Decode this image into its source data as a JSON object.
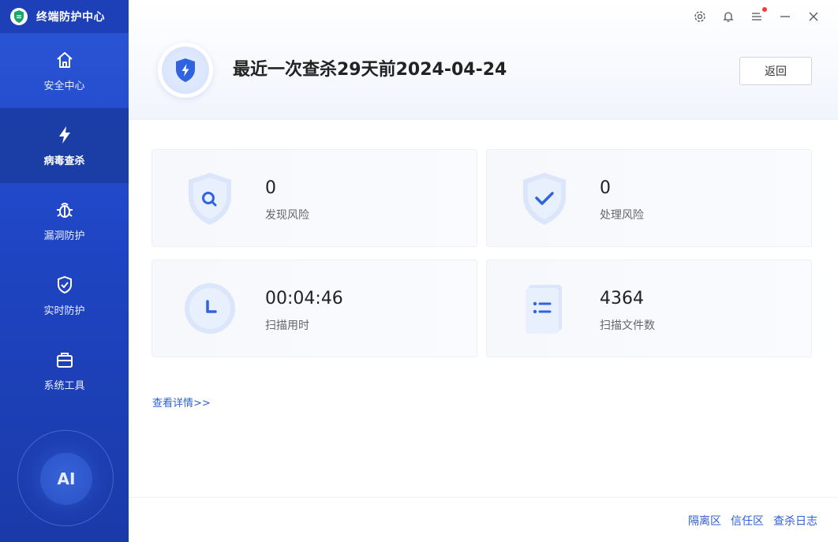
{
  "app": {
    "title": "终端防护中心"
  },
  "sidebar": {
    "items": [
      {
        "label": "安全中心",
        "icon": "home-icon"
      },
      {
        "label": "病毒查杀",
        "icon": "lightning-icon",
        "active": true
      },
      {
        "label": "漏洞防护",
        "icon": "bug-icon"
      },
      {
        "label": "实时防护",
        "icon": "shield-check-icon"
      },
      {
        "label": "系统工具",
        "icon": "toolbox-icon"
      }
    ],
    "ai_label": "AI"
  },
  "header": {
    "scan_title": "最近一次查杀29天前2024-04-24",
    "back_label": "返回"
  },
  "stats": [
    {
      "value": "0",
      "label": "发现风险",
      "icon": "shield-search-icon"
    },
    {
      "value": "0",
      "label": "处理风险",
      "icon": "shield-check-icon"
    },
    {
      "value": "00:04:46",
      "label": "扫描用时",
      "icon": "clock-icon"
    },
    {
      "value": "4364",
      "label": "扫描文件数",
      "icon": "file-list-icon"
    }
  ],
  "details_link": "查看详情>>",
  "footer": {
    "links": [
      "隔离区",
      "信任区",
      "查杀日志"
    ]
  },
  "colors": {
    "sidebar_bg": "#2a56d6",
    "accent": "#2e5ed8",
    "notification_dot": "#f03c3c"
  }
}
